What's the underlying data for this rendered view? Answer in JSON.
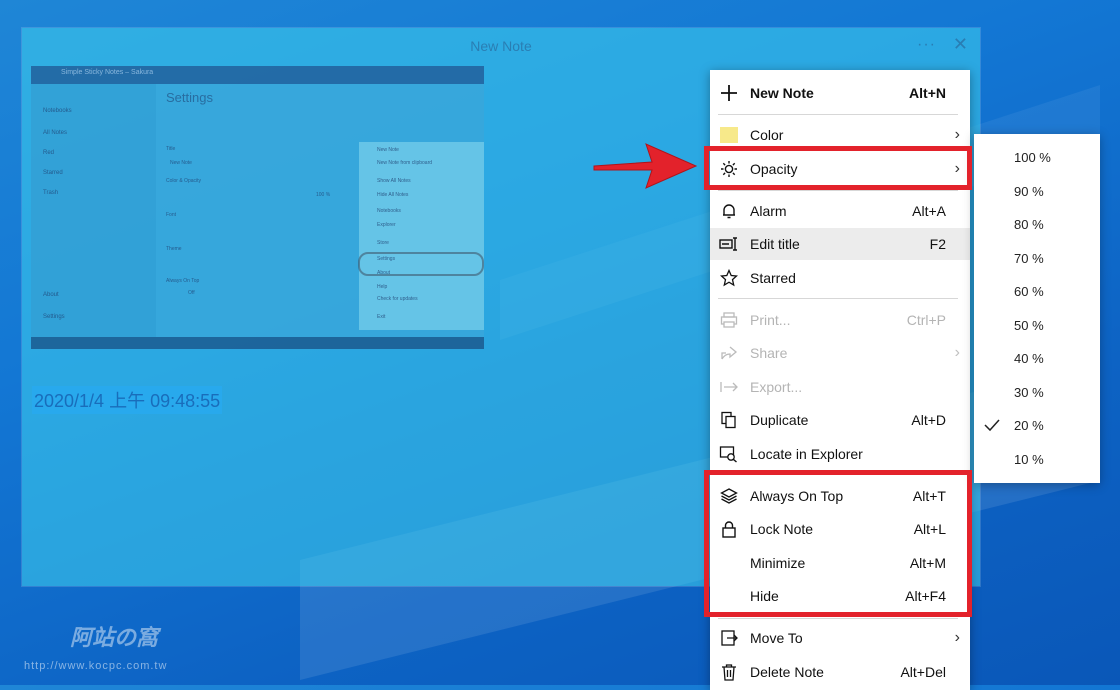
{
  "note_window": {
    "title": "New Note",
    "more_label": "···",
    "close_label": "✕",
    "content_text": "2020/1/4 上午 09:48:55",
    "embedded_screenshot": {
      "window_title": "Simple Sticky Notes – Sakura",
      "nav_items": [
        "Notebooks",
        "All Notes",
        "Red",
        "Starred",
        "Trash",
        "About",
        "Settings"
      ],
      "settings_heading": "Settings",
      "settings_labels": [
        "Title",
        "New Note",
        "Color & Opacity",
        "100 %",
        "Font",
        "Theme",
        "Always On Top",
        "Off"
      ],
      "menu_items": [
        "New Note",
        "New Note from clipboard",
        "Show All Notes",
        "Hide All Notes",
        "Notebooks",
        "Explorer",
        "Store",
        "Settings",
        "About",
        "Help",
        "Check for updates",
        "Exit"
      ]
    }
  },
  "watermark": {
    "text": "阿站の窩",
    "url": "http://www.kocpc.com.tw"
  },
  "context_menu": {
    "items": [
      {
        "label": "New Note",
        "shortcut": "Alt+N",
        "icon": "plus-icon",
        "bold": true
      },
      {
        "label": "Color",
        "shortcut": "",
        "icon": "color-swatch-icon",
        "submenu": true
      },
      {
        "label": "Opacity",
        "shortcut": "",
        "icon": "brightness-icon",
        "submenu": true
      },
      {
        "label": "Alarm",
        "shortcut": "Alt+A",
        "icon": "bell-icon"
      },
      {
        "label": "Edit title",
        "shortcut": "F2",
        "icon": "edit-title-icon",
        "hovered": true
      },
      {
        "label": "Starred",
        "shortcut": "",
        "icon": "star-icon"
      },
      {
        "label": "Print...",
        "shortcut": "Ctrl+P",
        "icon": "printer-icon",
        "disabled": true
      },
      {
        "label": "Share",
        "shortcut": "",
        "icon": "share-icon",
        "disabled": true,
        "submenu": true
      },
      {
        "label": "Export...",
        "shortcut": "",
        "icon": "export-icon",
        "disabled": true
      },
      {
        "label": "Duplicate",
        "shortcut": "Alt+D",
        "icon": "duplicate-icon"
      },
      {
        "label": "Locate in Explorer",
        "shortcut": "",
        "icon": "locate-icon"
      },
      {
        "label": "Always On Top",
        "shortcut": "Alt+T",
        "icon": "layers-icon"
      },
      {
        "label": "Lock Note",
        "shortcut": "Alt+L",
        "icon": "lock-icon"
      },
      {
        "label": "Minimize",
        "shortcut": "Alt+M",
        "icon": ""
      },
      {
        "label": "Hide",
        "shortcut": "Alt+F4",
        "icon": ""
      },
      {
        "label": "Move To",
        "shortcut": "",
        "icon": "move-to-icon",
        "submenu": true
      },
      {
        "label": "Delete Note",
        "shortcut": "Alt+Del",
        "icon": "trash-icon"
      }
    ],
    "submenu_arrow": "›"
  },
  "opacity_submenu": {
    "options": [
      "100 %",
      "90 %",
      "80 %",
      "70 %",
      "60 %",
      "50 %",
      "40 %",
      "30 %",
      "20 %",
      "10 %"
    ],
    "selected": "20 %"
  },
  "colors": {
    "highlight_red": "#e3222b",
    "color_swatch": "#f7e98a",
    "desktop_blue": "#1377d4"
  }
}
